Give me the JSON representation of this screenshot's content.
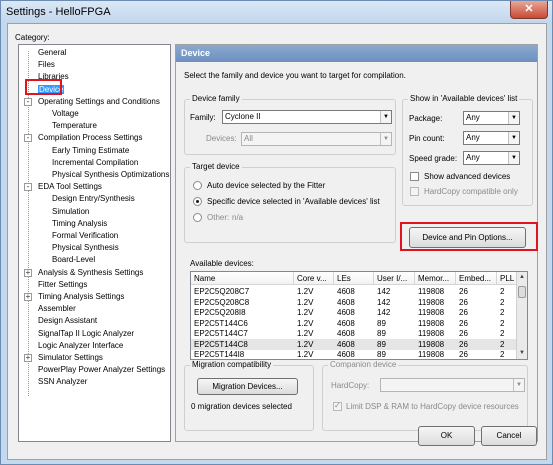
{
  "window": {
    "title": "Settings - HelloFPGA",
    "close_label": "✕"
  },
  "category_label": "Category:",
  "tree": {
    "items": [
      {
        "label": "General",
        "depth": 0,
        "expander": ""
      },
      {
        "label": "Files",
        "depth": 0,
        "expander": ""
      },
      {
        "label": "Libraries",
        "depth": 0,
        "expander": ""
      },
      {
        "label": "Device",
        "depth": 0,
        "expander": "",
        "selected": true
      },
      {
        "label": "Operating Settings and Conditions",
        "depth": 0,
        "expander": "-"
      },
      {
        "label": "Voltage",
        "depth": 1,
        "expander": ""
      },
      {
        "label": "Temperature",
        "depth": 1,
        "expander": ""
      },
      {
        "label": "Compilation Process Settings",
        "depth": 0,
        "expander": "-"
      },
      {
        "label": "Early Timing Estimate",
        "depth": 1,
        "expander": ""
      },
      {
        "label": "Incremental Compilation",
        "depth": 1,
        "expander": ""
      },
      {
        "label": "Physical Synthesis Optimizations",
        "depth": 1,
        "expander": ""
      },
      {
        "label": "EDA Tool Settings",
        "depth": 0,
        "expander": "-"
      },
      {
        "label": "Design Entry/Synthesis",
        "depth": 1,
        "expander": ""
      },
      {
        "label": "Simulation",
        "depth": 1,
        "expander": ""
      },
      {
        "label": "Timing Analysis",
        "depth": 1,
        "expander": ""
      },
      {
        "label": "Formal Verification",
        "depth": 1,
        "expander": ""
      },
      {
        "label": "Physical Synthesis",
        "depth": 1,
        "expander": ""
      },
      {
        "label": "Board-Level",
        "depth": 1,
        "expander": ""
      },
      {
        "label": "Analysis & Synthesis Settings",
        "depth": 0,
        "expander": "+"
      },
      {
        "label": "Fitter Settings",
        "depth": 0,
        "expander": ""
      },
      {
        "label": "Timing Analysis Settings",
        "depth": 0,
        "expander": "+"
      },
      {
        "label": "Assembler",
        "depth": 0,
        "expander": ""
      },
      {
        "label": "Design Assistant",
        "depth": 0,
        "expander": ""
      },
      {
        "label": "SignalTap II Logic Analyzer",
        "depth": 0,
        "expander": ""
      },
      {
        "label": "Logic Analyzer Interface",
        "depth": 0,
        "expander": ""
      },
      {
        "label": "Simulator Settings",
        "depth": 0,
        "expander": "+"
      },
      {
        "label": "PowerPlay Power Analyzer Settings",
        "depth": 0,
        "expander": ""
      },
      {
        "label": "SSN Analyzer",
        "depth": 0,
        "expander": ""
      }
    ]
  },
  "panel": {
    "header": "Device",
    "description": "Select the family and device you want to target for compilation.",
    "device_family": {
      "title": "Device family",
      "family_label": "Family:",
      "family_value": "Cyclone II",
      "devices_label": "Devices:",
      "devices_value": "All"
    },
    "target_device": {
      "title": "Target device",
      "auto_label": "Auto device selected by the Fitter",
      "specific_label": "Specific device selected in 'Available devices' list",
      "other_label": "Other:",
      "other_value": "n/a"
    },
    "show_in": {
      "title": "Show in 'Available devices' list",
      "package_label": "Package:",
      "package_value": "Any",
      "pin_count_label": "Pin count:",
      "pin_count_value": "Any",
      "speed_grade_label": "Speed grade:",
      "speed_grade_value": "Any",
      "show_advanced_label": "Show advanced devices",
      "hardcopy_compatible_label": "HardCopy compatible only"
    },
    "device_pin_options_label": "Device and Pin Options...",
    "available_devices": {
      "label": "Available devices:",
      "columns": [
        "Name",
        "Core v...",
        "LEs",
        "User I/...",
        "Memor...",
        "Embed...",
        "PLL"
      ],
      "rows": [
        [
          "EP2C5Q208C7",
          "1.2V",
          "4608",
          "142",
          "119808",
          "26",
          "2"
        ],
        [
          "EP2C5Q208C8",
          "1.2V",
          "4608",
          "142",
          "119808",
          "26",
          "2"
        ],
        [
          "EP2C5Q208I8",
          "1.2V",
          "4608",
          "142",
          "119808",
          "26",
          "2"
        ],
        [
          "EP2C5T144C6",
          "1.2V",
          "4608",
          "89",
          "119808",
          "26",
          "2"
        ],
        [
          "EP2C5T144C7",
          "1.2V",
          "4608",
          "89",
          "119808",
          "26",
          "2"
        ],
        [
          "EP2C5T144C8",
          "1.2V",
          "4608",
          "89",
          "119808",
          "26",
          "2"
        ],
        [
          "EP2C5T144I8",
          "1.2V",
          "4608",
          "89",
          "119808",
          "26",
          "2"
        ]
      ],
      "selected_row": 5
    },
    "migration": {
      "title": "Migration compatibility",
      "button_label": "Migration Devices...",
      "status": "0 migration devices selected"
    },
    "companion": {
      "title": "Companion device",
      "hardcopy_label": "HardCopy:",
      "limit_label": "Limit DSP & RAM to HardCopy device resources"
    }
  },
  "buttons": {
    "ok": "OK",
    "cancel": "Cancel"
  },
  "colors": {
    "accent": "#3399ff",
    "highlight_box": "#e0141e",
    "header": "#7b9bc7"
  }
}
